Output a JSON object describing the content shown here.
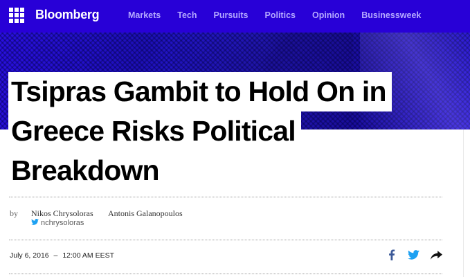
{
  "nav": {
    "logo": "Bloomberg",
    "links": [
      "Markets",
      "Tech",
      "Pursuits",
      "Politics",
      "Opinion",
      "Businessweek"
    ]
  },
  "article": {
    "headline_lines": [
      "Tsipras Gambit to Hold On in",
      "Greece Risks Political",
      "Breakdown"
    ],
    "by_label": "by",
    "authors": [
      "Nikos Chrysoloras",
      "Antonis Galanopoulos"
    ],
    "twitter_handle": "nchrysoloras",
    "date": "July 6, 2016",
    "separator": "–",
    "time": "12:00 AM EEST"
  },
  "share": {
    "icons": [
      "facebook-icon",
      "twitter-icon",
      "share-arrow-icon"
    ]
  },
  "colors": {
    "nav_background": "#2800d7",
    "nav_link": "#b4a8ff",
    "facebook": "#3b5998",
    "twitter": "#1da1f2"
  }
}
